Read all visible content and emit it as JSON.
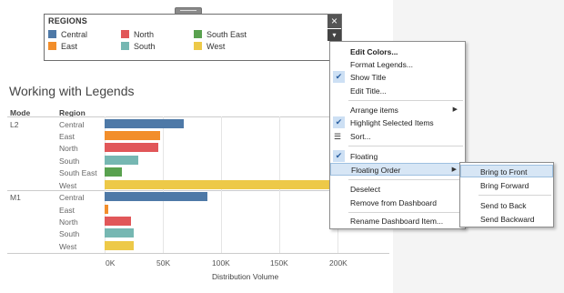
{
  "legend": {
    "title": "REGIONS",
    "items": [
      {
        "label": "Central",
        "color": "#4e79a7"
      },
      {
        "label": "North",
        "color": "#e15759"
      },
      {
        "label": "South East",
        "color": "#59a14f"
      },
      {
        "label": "East",
        "color": "#f28e2b"
      },
      {
        "label": "South",
        "color": "#76b7b2"
      },
      {
        "label": "West",
        "color": "#edc948"
      }
    ],
    "close_icon": "×",
    "dropdown_icon": "▾"
  },
  "chart": {
    "title": "Working with Legends",
    "col_mode": "Mode",
    "col_region": "Region",
    "axis_title": "Distribution Volume",
    "ticks": [
      "0K",
      "50K",
      "100K",
      "150K",
      "200K"
    ]
  },
  "chart_data": {
    "type": "bar",
    "title": "Working with Legends",
    "xlabel": "Distribution Volume",
    "ylabel": "",
    "xlim": [
      0,
      200000
    ],
    "groups": [
      {
        "mode": "L2",
        "rows": [
          {
            "region": "Central",
            "value": 68000,
            "color": "#4e79a7"
          },
          {
            "region": "East",
            "value": 48000,
            "color": "#f28e2b"
          },
          {
            "region": "North",
            "value": 46000,
            "color": "#e15759"
          },
          {
            "region": "South",
            "value": 29000,
            "color": "#76b7b2"
          },
          {
            "region": "South East",
            "value": 15000,
            "color": "#59a14f"
          },
          {
            "region": "West",
            "value": 200000,
            "color": "#edc948"
          }
        ]
      },
      {
        "mode": "M1",
        "rows": [
          {
            "region": "Central",
            "value": 88000,
            "color": "#4e79a7"
          },
          {
            "region": "East",
            "value": 3000,
            "color": "#f28e2b"
          },
          {
            "region": "North",
            "value": 23000,
            "color": "#e15759"
          },
          {
            "region": "South",
            "value": 25000,
            "color": "#76b7b2"
          },
          {
            "region": "West",
            "value": 25000,
            "color": "#edc948"
          }
        ]
      }
    ]
  },
  "menu": {
    "edit_colors": "Edit Colors...",
    "format_legends": "Format Legends...",
    "show_title": "Show Title",
    "edit_title": "Edit Title...",
    "arrange_items": "Arrange items",
    "highlight_selected": "Highlight Selected Items",
    "sort": "Sort...",
    "floating": "Floating",
    "floating_order": "Floating Order",
    "deselect": "Deselect",
    "remove": "Remove from Dashboard",
    "rename": "Rename Dashboard Item...",
    "check_glyph": "✔",
    "arrow_glyph": "▶",
    "sort_glyph": "☰"
  },
  "submenu": {
    "bring_to_front": "Bring to Front",
    "bring_forward": "Bring Forward",
    "send_to_back": "Send to Back",
    "send_backward": "Send Backward"
  }
}
